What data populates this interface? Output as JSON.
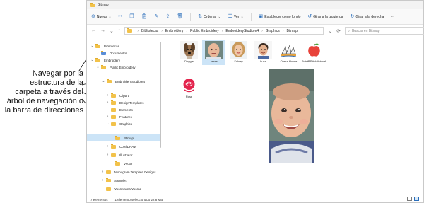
{
  "callout": {
    "text": "Navegar por la estructura de la carpeta a través del árbol de navegación o la barra de direcciones"
  },
  "window": {
    "title": "Bitmap"
  },
  "toolbar": {
    "new": "Nuevo",
    "sort": "Ordenar",
    "view": "Ver",
    "set_background": "Establecer como fondo",
    "rotate_left": "Girar a la izquierda",
    "rotate_right": "Girar a la derecha",
    "more": "···"
  },
  "address": {
    "crumbs": [
      "Bibliotecas",
      "Embroidery",
      "Public Embroidery",
      "EmbroideryStudio e4",
      "Graphics",
      "Bitmap"
    ],
    "search_placeholder": "Buscar en Bitmap"
  },
  "tree": [
    {
      "label": "Bibliotecas",
      "expanded": true
    },
    {
      "label": "Documentos",
      "expanded": false
    },
    {
      "label": "Embroidery",
      "expanded": true
    },
    {
      "label": "Public Embroidery",
      "expanded": true
    },
    {
      "label": "EmbroideryStudio e4",
      "expanded": true
    },
    {
      "label": "Clipart",
      "expanded": false
    },
    {
      "label": "DesignTemplates",
      "expanded": false
    },
    {
      "label": "Elements",
      "expanded": null
    },
    {
      "label": "Features",
      "expanded": false
    },
    {
      "label": "Graphics",
      "expanded": true
    },
    {
      "label": "Bitmap",
      "expanded": null,
      "selected": true
    },
    {
      "label": "CorelDRAW",
      "expanded": false
    },
    {
      "label": "Illustrator",
      "expanded": false
    },
    {
      "label": "Vector",
      "expanded": null
    },
    {
      "label": "Monogram Template Designs",
      "expanded": false
    },
    {
      "label": "Samples",
      "expanded": false
    },
    {
      "label": "Yearmonna Yearns",
      "expanded": null
    }
  ],
  "files": [
    {
      "name": "Doggie",
      "kind": "dog"
    },
    {
      "name": "Jesse",
      "kind": "baby",
      "selected": true
    },
    {
      "name": "Kelsey",
      "kind": "girl"
    },
    {
      "name": "Luca",
      "kind": "boy"
    },
    {
      "name": "Opera House",
      "kind": "opera"
    },
    {
      "name": "PointBStitchArtwork",
      "kind": "apple"
    },
    {
      "name": "Rose",
      "kind": "rose"
    }
  ],
  "status": {
    "count": "7 elementos",
    "selection": "1 elemento seleccionado  22,8 MB"
  },
  "icons": {
    "new": "plus-circle-icon",
    "cut": "scissors-icon",
    "copy": "copy-icon",
    "paste": "clipboard-icon",
    "rename": "rename-icon",
    "share": "share-icon",
    "delete": "trash-icon",
    "sort": "sort-icon",
    "view": "view-icon"
  },
  "colors": {
    "accent": "#2a6ebb",
    "selection": "#cce4f7",
    "folder": "#f2c24a"
  }
}
